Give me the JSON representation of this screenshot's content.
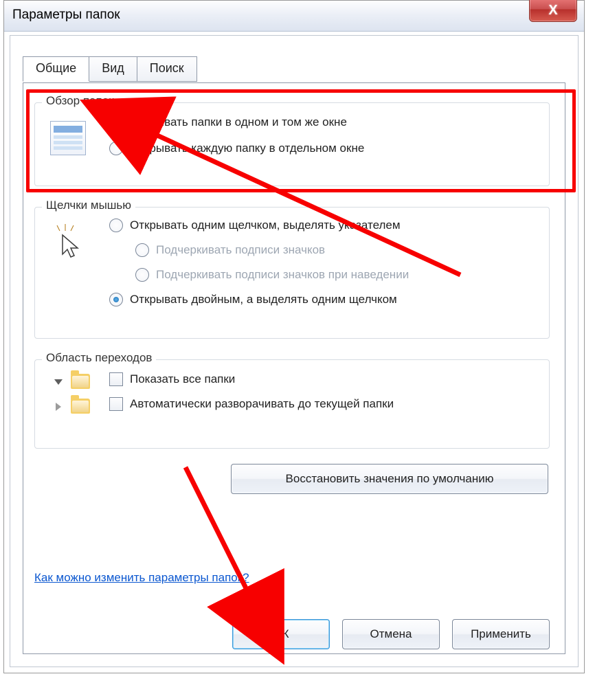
{
  "window": {
    "title": "Параметры папок"
  },
  "tabs": {
    "general": "Общие",
    "view": "Вид",
    "search": "Поиск"
  },
  "group_browse": {
    "title": "Обзор папок",
    "opt_same": "Открывать папки в одном и том же окне",
    "opt_each": "Открывать каждую папку в отдельном окне"
  },
  "group_click": {
    "title": "Щелчки мышью",
    "opt_single": "Открывать одним щелчком, выделять указателем",
    "sub_always": "Подчеркивать подписи значков",
    "sub_hover": "Подчеркивать подписи значков при наведении",
    "opt_double": "Открывать двойным, а выделять одним щелчком"
  },
  "group_nav": {
    "title": "Область переходов",
    "chk_all": "Показать все папки",
    "chk_auto": "Автоматически разворачивать до текущей папки"
  },
  "buttons": {
    "restore": "Восстановить значения по умолчанию",
    "ok": "ОК",
    "cancel": "Отмена",
    "apply": "Применить"
  },
  "link": {
    "help": "Как можно изменить параметры папок?"
  }
}
